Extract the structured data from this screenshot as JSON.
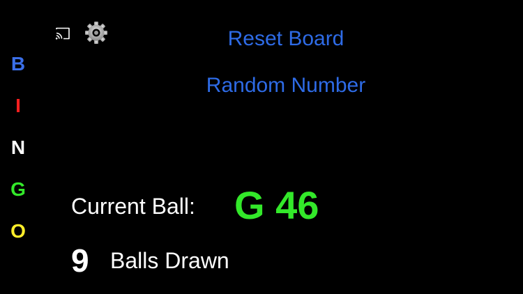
{
  "header": {
    "cast_icon": "cast-icon",
    "settings_icon": "gear-icon"
  },
  "bingo_letters": [
    {
      "letter": "B",
      "color": "#3b6fe8"
    },
    {
      "letter": "I",
      "color": "#ff1f1f"
    },
    {
      "letter": "N",
      "color": "#ffffff"
    },
    {
      "letter": "G",
      "color": "#33e82a"
    },
    {
      "letter": "O",
      "color": "#ffee2a"
    }
  ],
  "actions": {
    "reset_label": "Reset Board",
    "random_label": "Random Number",
    "link_color": "#2e6be6"
  },
  "status": {
    "current_ball_label": "Current Ball:",
    "current_ball_value": "G 46",
    "current_ball_color": "#33e82a",
    "balls_drawn_count": "9",
    "balls_drawn_label": "Balls Drawn"
  }
}
